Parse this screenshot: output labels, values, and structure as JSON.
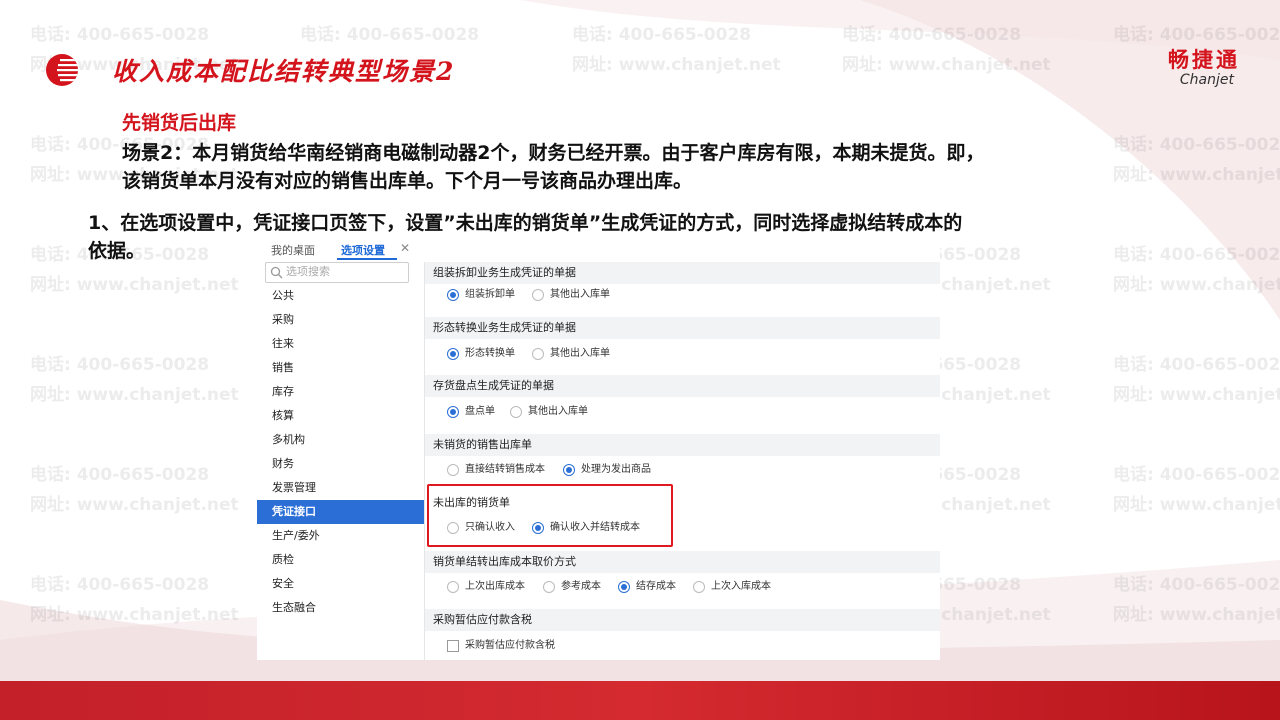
{
  "header": {
    "deck_title": "收入成本配比结转典型场景2",
    "brand_cn": "畅捷通",
    "brand_en": "Chanjet"
  },
  "watermark": {
    "phone": "电话: 400-665-0028",
    "site": "网址: www.chanjet.net"
  },
  "body": {
    "sub_title": "先销货后出库",
    "scenario_line1": "场景2：本月销货给华南经销商电磁制动器2个，财务已经开票。由于客户库房有限，本期未提货。即，",
    "scenario_line2": "该销货单本月没有对应的销售出库单。下个月一号该商品办理出库。",
    "step_line1": "1、在选项设置中，凭证接口页签下，设置”未出库的销货单”生成凭证的方式，同时选择虚拟结转成本的",
    "step_line2": "依据。"
  },
  "app": {
    "tabs": [
      {
        "label": "我的桌面"
      },
      {
        "label": "选项设置"
      }
    ],
    "search_placeholder": "选项搜索",
    "sidebar": [
      {
        "label": "公共"
      },
      {
        "label": "采购"
      },
      {
        "label": "往来"
      },
      {
        "label": "销售"
      },
      {
        "label": "库存"
      },
      {
        "label": "核算"
      },
      {
        "label": "多机构"
      },
      {
        "label": "财务"
      },
      {
        "label": "发票管理"
      },
      {
        "label": "凭证接口",
        "active": true
      },
      {
        "label": "生产/委外"
      },
      {
        "label": "质检"
      },
      {
        "label": "安全"
      },
      {
        "label": "生态融合"
      }
    ],
    "sections": [
      {
        "title": "组装拆卸业务生成凭证的单据",
        "options": [
          {
            "label": "组装拆卸单",
            "checked": true
          },
          {
            "label": "其他出入库单",
            "checked": false
          }
        ]
      },
      {
        "title": "形态转换业务生成凭证的单据",
        "options": [
          {
            "label": "形态转换单",
            "checked": true
          },
          {
            "label": "其他出入库单",
            "checked": false
          }
        ]
      },
      {
        "title": "存货盘点生成凭证的单据",
        "options": [
          {
            "label": "盘点单",
            "checked": true
          },
          {
            "label": "其他出入库单",
            "checked": false
          }
        ]
      },
      {
        "title": "未销货的销售出库单",
        "options": [
          {
            "label": "直接结转销售成本",
            "checked": false
          },
          {
            "label": "处理为发出商品",
            "checked": true
          }
        ]
      },
      {
        "title": "未出库的销货单",
        "options": [
          {
            "label": "只确认收入",
            "checked": false
          },
          {
            "label": "确认收入并结转成本",
            "checked": true
          }
        ]
      },
      {
        "title": "销货单结转出库成本取价方式",
        "options": [
          {
            "label": "上次出库成本",
            "checked": false
          },
          {
            "label": "参考成本",
            "checked": false
          },
          {
            "label": "结存成本",
            "checked": true
          },
          {
            "label": "上次入库成本",
            "checked": false
          }
        ]
      },
      {
        "title": "采购暂估应付款含税",
        "options": [
          {
            "label": "采购暂估应付款含税",
            "checked": false,
            "checkbox": true
          }
        ]
      }
    ]
  },
  "colors": {
    "accent_red": "#d4141c",
    "accent_blue": "#2b6fd6",
    "highlight_box": "#e0191f"
  }
}
